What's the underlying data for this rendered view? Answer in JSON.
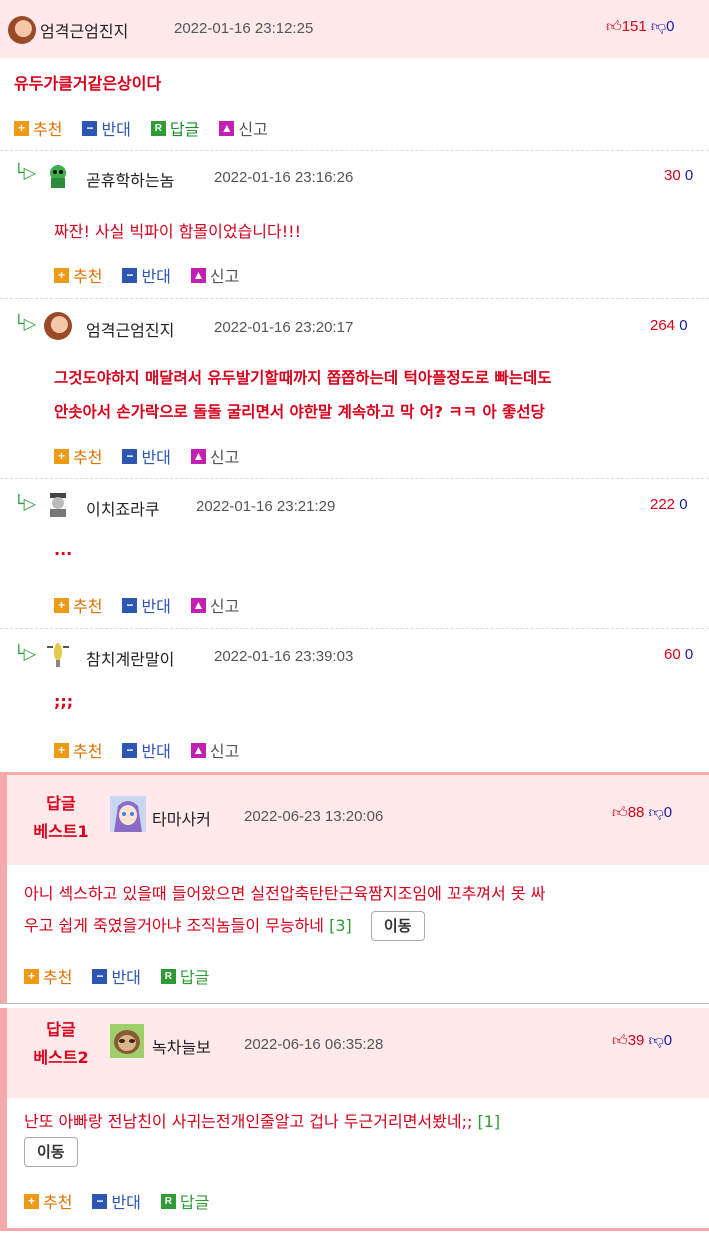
{
  "top_comment": {
    "nickname": "엄격근엄진지",
    "date": "2022-01-16 23:12:25",
    "up_count": "151",
    "down_count": "0",
    "body": "유두가클거같은상이다",
    "actions": {
      "recommend": "추천",
      "oppose": "반대",
      "reply": "답글",
      "report": "신고"
    }
  },
  "replies": [
    {
      "nickname": "곧휴학하는놈",
      "date": "2022-01-16 23:16:26",
      "up": "30",
      "down": "0",
      "lines": [
        "짜잔! 사실 빅파이 함몰이었습니다!!!"
      ]
    },
    {
      "nickname": "엄격근엄진지",
      "date": "2022-01-16 23:20:17",
      "up": "264",
      "down": "0",
      "lines": [
        "그것도야하지 매달려서 유두발기할때까지 쫍쫍하는데 턱아플정도로 빠는데도",
        "안솟아서 손가락으로 돌돌 굴리면서 야한말 계속하고 막 어? ㅋㅋ 아 좋선당"
      ]
    },
    {
      "nickname": "이치죠라쿠",
      "date": "2022-01-16 23:21:29",
      "up": "222",
      "down": "0",
      "lines": [
        "..."
      ]
    },
    {
      "nickname": "참치계란말이",
      "date": "2022-01-16 23:39:03",
      "up": "60",
      "down": "0",
      "lines": [
        ";;;"
      ]
    }
  ],
  "reply_actions": {
    "recommend": "추천",
    "oppose": "반대",
    "report": "신고"
  },
  "best": [
    {
      "label_line1": "답글",
      "label_line2": "베스트1",
      "nickname": "타마사커",
      "date": "2022-06-23 13:20:06",
      "up": "88",
      "down": "0",
      "line1": "아니 섹스하고 있을때 들어왔으면 실전압축탄탄근육짬지조임에 꼬추껴서 못 싸",
      "line2": "우고 쉽게 죽였을거아냐 조직놈들이 무능하네",
      "ref": "[3]",
      "move": "이동",
      "actions": {
        "recommend": "추천",
        "oppose": "반대",
        "reply": "답글"
      }
    },
    {
      "label_line1": "답글",
      "label_line2": "베스트2",
      "nickname": "녹차늘보",
      "date": "2022-06-16 06:35:28",
      "up": "39",
      "down": "0",
      "line1": "난또 아빠랑 전남친이 사귀는전개인줄알고 겁나 두근거리면서봤네;;",
      "ref": "[1]",
      "move": "이동",
      "actions": {
        "recommend": "추천",
        "oppose": "반대",
        "reply": "답글"
      }
    }
  ],
  "colors": {
    "accent_red": "#d8001b",
    "best_bg": "#ffe9ea",
    "best_border": "#f6a9aa"
  }
}
